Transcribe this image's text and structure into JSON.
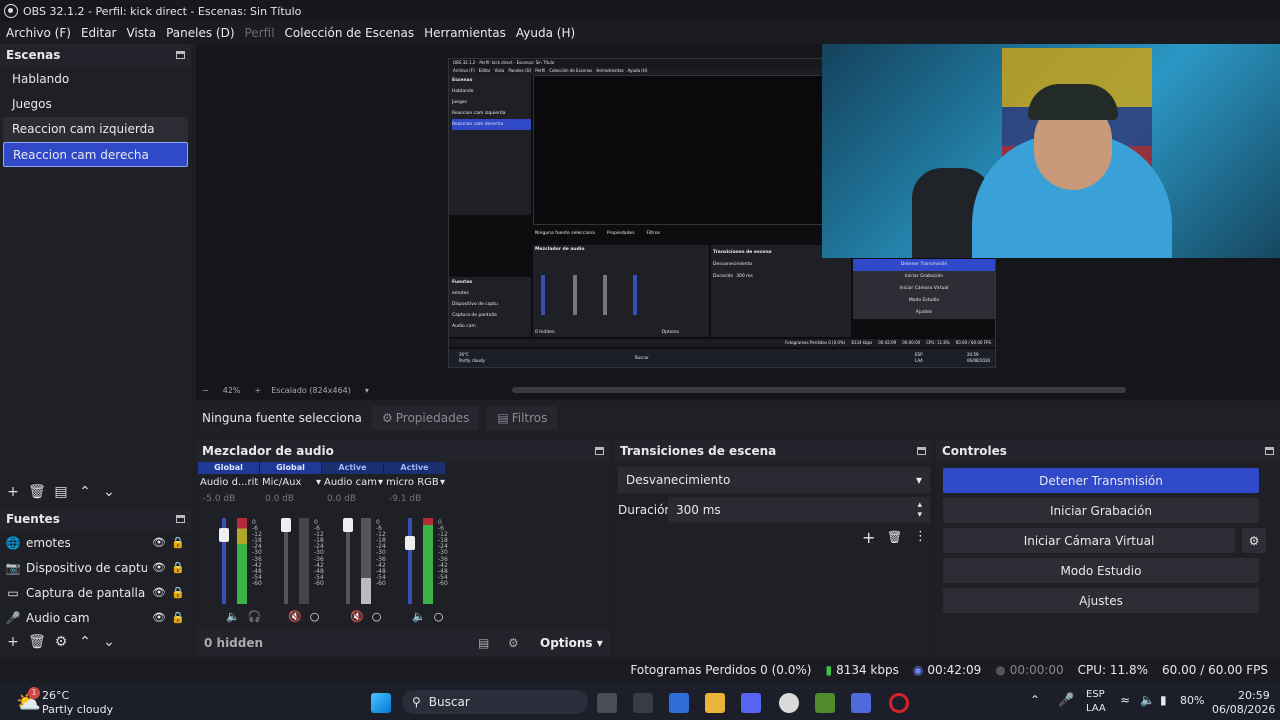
{
  "titlebar": {
    "title": "OBS 32.1.2 - Perfil: kick direct - Escenas: Sin Título"
  },
  "menu": [
    "Archivo (F)",
    "Editar",
    "Vista",
    "Paneles (D)",
    "Perfil",
    "Colección de Escenas",
    "Herramientas",
    "Ayuda (H)"
  ],
  "scenes": {
    "title": "Escenas",
    "items": [
      "Hablando",
      "Juegos",
      "Reaccion cam izquierda",
      "Reaccion cam derecha"
    ],
    "selected": "Reaccion cam derecha"
  },
  "sources": {
    "title": "Fuentes",
    "items": [
      "emotes",
      "Dispositivo de captu",
      "Captura de pantalla",
      "Audio cam"
    ]
  },
  "preview": {
    "zoom": "42%",
    "scale_label": "Escalado (824x464)",
    "inner": {
      "title": "OBS 32.1.2 - Perfil: kick direct - Escenas: Sin Título",
      "menu": [
        "Archivo (F)",
        "Editar",
        "Vista",
        "Paneles (D)",
        "Perfil",
        "Colección de Escenas",
        "Herramientas",
        "Ayuda (H)"
      ],
      "scenes_title": "Escenas",
      "scenes": [
        "Hablando",
        "Juegos",
        "Reaccion cam izquierda",
        "Reaccion cam derecha"
      ],
      "sources_title": "Fuentes",
      "sources": [
        "emotes",
        "Dispositivo de captu",
        "Captura de pantalla",
        "Audio cam"
      ],
      "no_source": "Ninguna fuente selecciona",
      "props": "Propiedades",
      "filters": "Filtros",
      "mixer_title": "Mezclador de audio",
      "trans_title": "Transiciones de escena",
      "trans_value": "Desvanecimiento",
      "duration_label": "Duración",
      "duration_value": "300 ms",
      "controls": [
        "Detener Transmisión",
        "Iniciar Grabación",
        "Iniciar Cámara Virtual",
        "Modo Estudio",
        "Ajustes"
      ],
      "hidden": "0 hidden",
      "options": "Options",
      "status": "Fotogramas Perdidos 0 (0.0%)",
      "kbps": "8134 kbps",
      "time": "00:42:09",
      "rec": "00:00:00",
      "cpu": "CPU: 11.8%",
      "fps": "60.00 / 60.00 FPS",
      "weather_temp": "26°C",
      "weather_desc": "Partly cloudy",
      "search": "Buscar",
      "lang": "ESP",
      "lang2": "LAA",
      "clock": "20:59",
      "date": "06/08/2026"
    }
  },
  "source_toolbar": {
    "no_source": "Ninguna fuente selecciona",
    "properties": "Propiedades",
    "filters": "Filtros"
  },
  "mixer": {
    "title": "Mezclador de audio",
    "channels": [
      {
        "badge": "Global",
        "name": "Audio d...ritorio",
        "db": "-5.0 dB",
        "level": 0.86
      },
      {
        "badge": "Global",
        "name": "Mic/Aux",
        "db": "0.0 dB",
        "level": 1.0
      },
      {
        "badge": "Active",
        "name": "Audio cam",
        "db": "0.0 dB",
        "level": 1.0
      },
      {
        "badge": "Active",
        "name": "micro RGB",
        "db": "-9.1 dB",
        "level": 0.75
      }
    ],
    "scale": [
      "0",
      "-6",
      "-12",
      "-18",
      "-24",
      "-30",
      "-36",
      "-42",
      "-48",
      "-54",
      "-60"
    ],
    "hidden": "0 hidden",
    "options": "Options"
  },
  "transitions": {
    "title": "Transiciones de escena",
    "value": "Desvanecimiento",
    "duration_label": "Duración",
    "duration_value": "300 ms"
  },
  "controls": {
    "title": "Controles",
    "buttons": [
      "Detener Transmisión",
      "Iniciar Grabación",
      "Iniciar Cámara Virtual",
      "Modo Estudio",
      "Ajustes"
    ]
  },
  "status": {
    "dropped": "Fotogramas Perdidos 0 (0.0%)",
    "kbps": "8134 kbps",
    "stream_time": "00:42:09",
    "rec_time": "00:00:00",
    "cpu": "CPU: 11.8%",
    "fps": "60.00 / 60.00 FPS"
  },
  "taskbar": {
    "weather_temp": "26°C",
    "weather_desc": "Partly cloudy",
    "weather_badge": "1",
    "search": "Buscar",
    "lang": "ESP",
    "lang2": "LAA",
    "battery": "80%",
    "clock": "20:59",
    "date": "06/08/2026"
  },
  "colors": {
    "accent": "#2f49c9",
    "bg": "#1f2026"
  }
}
